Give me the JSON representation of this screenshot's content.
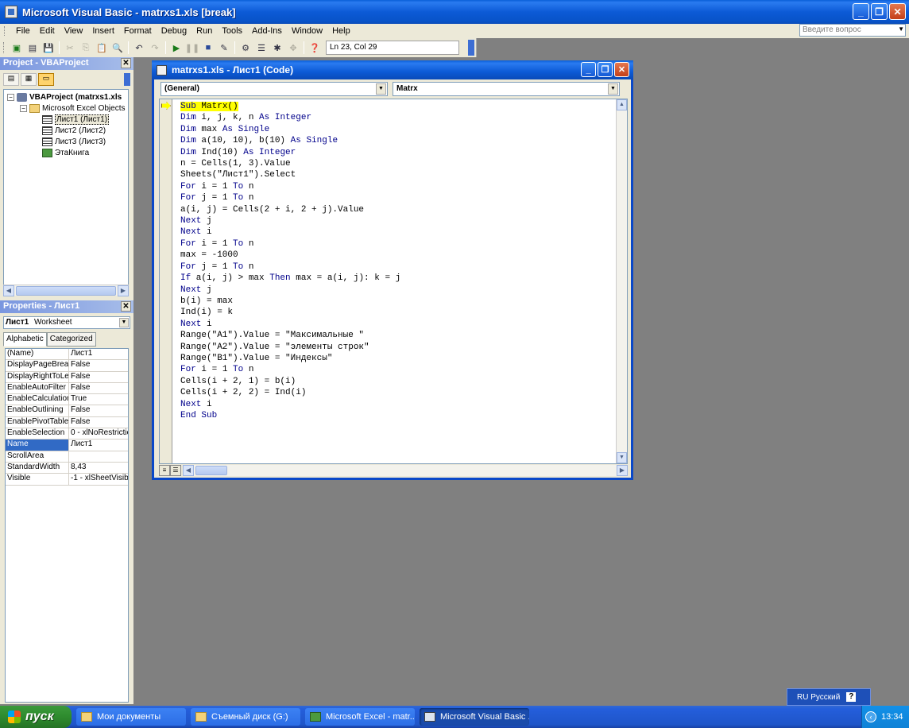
{
  "window": {
    "title": "Microsoft Visual Basic - matrxs1.xls [break]"
  },
  "menu": {
    "items": [
      "File",
      "Edit",
      "View",
      "Insert",
      "Format",
      "Debug",
      "Run",
      "Tools",
      "Add-Ins",
      "Window",
      "Help"
    ],
    "help_placeholder": "Введите вопрос"
  },
  "toolbar": {
    "position": "Ln 23, Col 29"
  },
  "project": {
    "title": "Project - VBAProject",
    "tree": [
      {
        "label": "VBAProject (matrxs1.xls",
        "level": 0,
        "icon": "project-icon",
        "expander": "−"
      },
      {
        "label": "Microsoft Excel Objects",
        "level": 1,
        "icon": "folder-icon",
        "expander": "−"
      },
      {
        "label": "Лист1 (Лист1)",
        "level": 2,
        "icon": "sheet-icon",
        "selected": true
      },
      {
        "label": "Лист2 (Лист2)",
        "level": 2,
        "icon": "sheet-icon"
      },
      {
        "label": "Лист3 (Лист3)",
        "level": 2,
        "icon": "sheet-icon"
      },
      {
        "label": "ЭтаКнига",
        "level": 2,
        "icon": "workbook-icon"
      }
    ]
  },
  "properties": {
    "title": "Properties - Лист1",
    "object_name": "Лист1",
    "object_type": "Worksheet",
    "tabs": [
      "Alphabetic",
      "Categorized"
    ],
    "rows": [
      {
        "name": "(Name)",
        "value": "Лист1"
      },
      {
        "name": "DisplayPageBreak",
        "value": "False"
      },
      {
        "name": "DisplayRightToLef",
        "value": "False"
      },
      {
        "name": "EnableAutoFilter",
        "value": "False"
      },
      {
        "name": "EnableCalculation",
        "value": "True"
      },
      {
        "name": "EnableOutlining",
        "value": "False"
      },
      {
        "name": "EnablePivotTable",
        "value": "False"
      },
      {
        "name": "EnableSelection",
        "value": "0 - xlNoRestrictio"
      },
      {
        "name": "Name",
        "value": "Лист1",
        "selected": true
      },
      {
        "name": "ScrollArea",
        "value": ""
      },
      {
        "name": "StandardWidth",
        "value": "8,43"
      },
      {
        "name": "Visible",
        "value": "-1 - xlSheetVisib"
      }
    ]
  },
  "code_window": {
    "title": "matrxs1.xls - Лист1 (Code)",
    "object_combo": "(General)",
    "proc_combo": "Matrx",
    "lines": [
      "Sub Matrx()",
      "Dim i, j, k, n As Integer",
      "Dim max As Single",
      "Dim a(10, 10), b(10) As Single",
      "Dim Ind(10) As Integer",
      "n = Cells(1, 3).Value",
      "Sheets(\"Лист1\").Select",
      "For i = 1 To n",
      "For j = 1 To n",
      "a(i, j) = Cells(2 + i, 2 + j).Value",
      "Next j",
      "Next i",
      "For i = 1 To n",
      "max = -1000",
      "For j = 1 To n",
      "If a(i, j) > max Then max = a(i, j): k = j",
      "Next j",
      "b(i) = max",
      "Ind(i) = k",
      "Next i",
      "Range(\"A1\").Value = \"Максимальные \"",
      "Range(\"A2\").Value = \"элементы строк\"",
      "Range(\"B1\").Value = \"Индексы\"",
      "For i = 1 To n",
      "Cells(i + 2, 1) = b(i)",
      "Cells(i + 2, 2) = Ind(i)",
      "Next i",
      "End Sub"
    ]
  },
  "language_bar": {
    "label": "RU Русский"
  },
  "taskbar": {
    "start": "пуск",
    "tasks": [
      {
        "label": "Мои документы",
        "icon": "folder"
      },
      {
        "label": "Съемный диск (G:)",
        "icon": "folder"
      },
      {
        "label": "Microsoft Excel - matr...",
        "icon": "xl"
      },
      {
        "label": "Microsoft Visual Basic ...",
        "icon": "vb",
        "active": true
      }
    ],
    "clock": "13:34"
  }
}
